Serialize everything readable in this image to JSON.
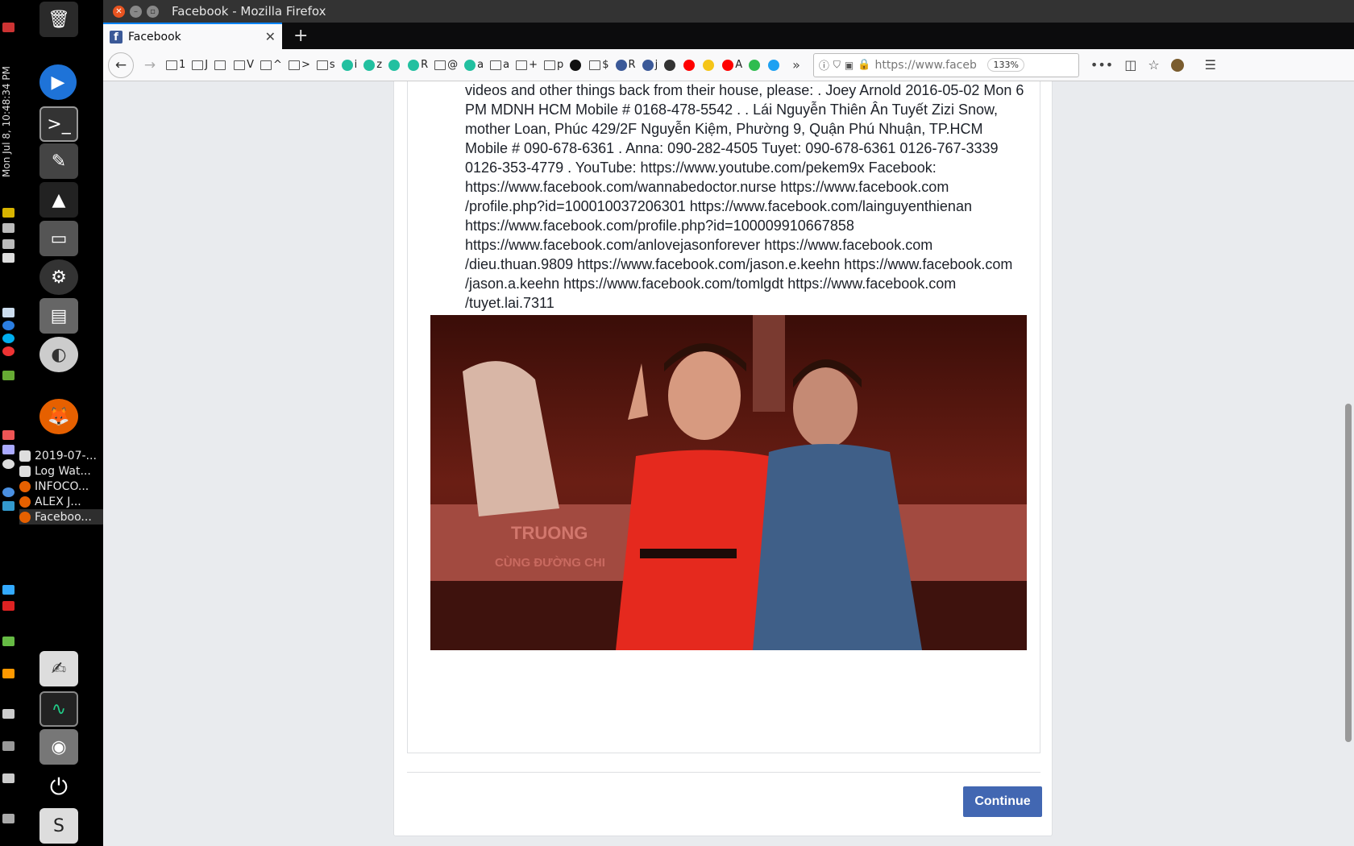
{
  "system": {
    "clock": "Mon Jul 8, 10:48:34 PM",
    "open_windows": [
      {
        "label": "2019-07-...",
        "icon_color": "#dddddd"
      },
      {
        "label": "Log Wat...",
        "icon_color": "#dddddd"
      },
      {
        "label": "INFOCO...",
        "icon_color": "#e66000"
      },
      {
        "label": "ALEX J...",
        "icon_color": "#e66000"
      },
      {
        "label": "Faceboo...",
        "icon_color": "#e66000"
      }
    ]
  },
  "browser": {
    "window_title": "Facebook - Mozilla Firefox",
    "tab_label": "Facebook",
    "url": "https://www.faceb",
    "zoom": "133%",
    "bookmarks": [
      {
        "label": "1",
        "kind": "folder"
      },
      {
        "label": "J",
        "kind": "folder"
      },
      {
        "label": "",
        "kind": "folder"
      },
      {
        "label": "V",
        "kind": "folder"
      },
      {
        "label": "^",
        "kind": "folder"
      },
      {
        "label": ">",
        "kind": "folder"
      },
      {
        "label": "s",
        "kind": "folder"
      },
      {
        "label": "i",
        "kind": "circle",
        "color": "#22c0a0"
      },
      {
        "label": "z",
        "kind": "circle",
        "color": "#22c0a0"
      },
      {
        "label": "",
        "kind": "circle",
        "color": "#22c0a0"
      },
      {
        "label": "R",
        "kind": "circle",
        "color": "#22c0a0"
      },
      {
        "label": "@",
        "kind": "folder"
      },
      {
        "label": "a",
        "kind": "circle",
        "color": "#22c0a0"
      },
      {
        "label": "a",
        "kind": "folder"
      },
      {
        "label": "+",
        "kind": "folder"
      },
      {
        "label": "p",
        "kind": "folder"
      },
      {
        "label": "",
        "kind": "circle",
        "color": "#111111"
      },
      {
        "label": "$",
        "kind": "folder"
      },
      {
        "label": "R",
        "kind": "circle",
        "color": "#3b5998"
      },
      {
        "label": "j",
        "kind": "circle",
        "color": "#3b5998"
      },
      {
        "label": "",
        "kind": "circle",
        "color": "#333333"
      },
      {
        "label": "",
        "kind": "circle",
        "color": "#ff0000"
      },
      {
        "label": "",
        "kind": "circle",
        "color": "#f5c518"
      },
      {
        "label": "A",
        "kind": "circle",
        "color": "#ff0000"
      },
      {
        "label": "",
        "kind": "circle",
        "color": "#2fbc4f"
      },
      {
        "label": "",
        "kind": "circle",
        "color": "#1da1f2"
      }
    ]
  },
  "post": {
    "text": "videos and other things back from their house, please: . Joey Arnold 2016-05-02 Mon 6 PM MDNH HCM Mobile # 0168-478-5542 . . Lái Nguyễn Thiên Ân Tuyết Zizi Snow, mother Loan, Phúc 429/2F Nguyễn Kiệm, Phường 9, Quận Phú Nhuận, TP.HCM Mobile # 090-678-6361 . Anna: 090-282-4505 Tuyet: 090-678-6361 0126-767-3339 0126-353-4779 . YouTube: https://www.youtube.com/pekem9x Facebook: https://www.facebook.com/wannabedoctor.nurse https://www.facebook.com /profile.php?id=100010037206301 https://www.facebook.com/lainguyenthienan https://www.facebook.com/profile.php?id=100009910667858 https://www.facebook.com/anlovejasonforever https://www.facebook.com /dieu.thuan.9809 https://www.facebook.com/jason.e.keehn https://www.facebook.com /jason.a.keehn https://www.facebook.com/tomlgdt https://www.facebook.com /tuyet.lai.7311",
    "photo_bench_text": "TRUONG",
    "photo_bench_text2": "CÙNG ĐƯỜNG CHI"
  },
  "actions": {
    "continue_label": "Continue"
  }
}
